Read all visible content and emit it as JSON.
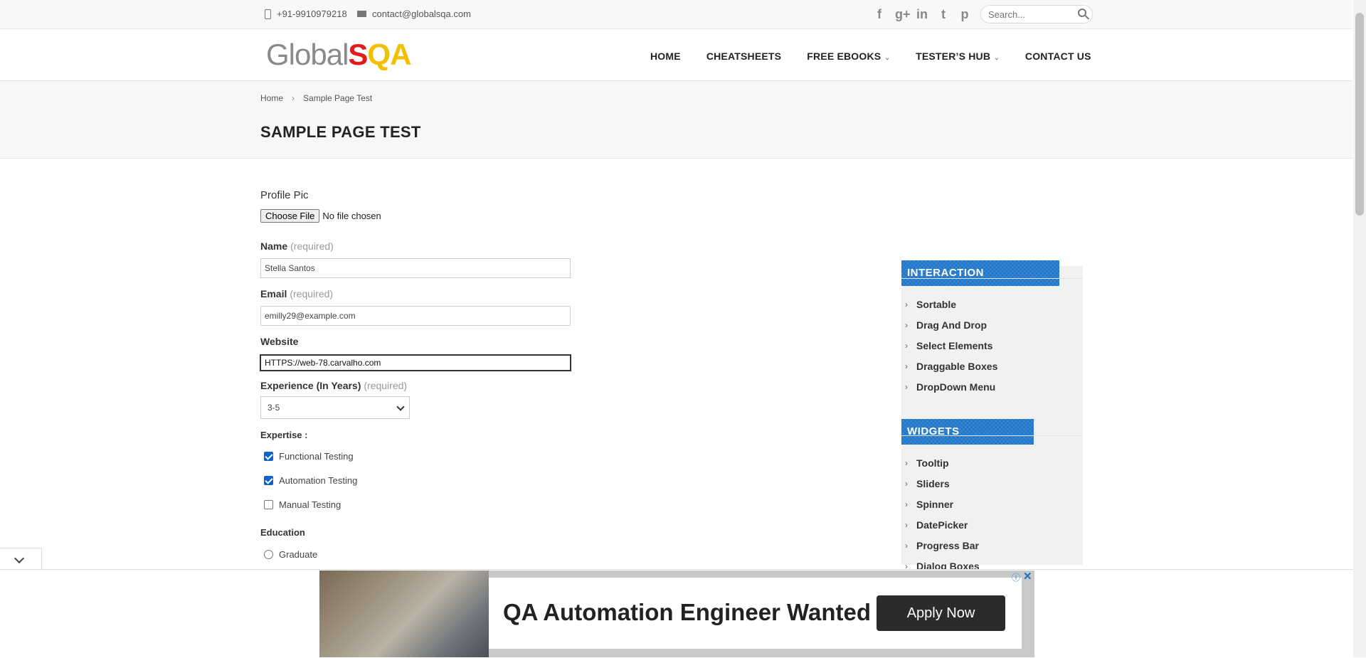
{
  "topbar": {
    "phone": "+91-9910979218",
    "email": "contact@globalsqa.com",
    "social": [
      "facebook-icon",
      "google-plus-icon",
      "linkedin-icon",
      "twitter-icon",
      "pinterest-icon"
    ],
    "social_glyphs": [
      "f",
      "g+",
      "in",
      "t",
      "p"
    ],
    "search_placeholder": "Search..."
  },
  "logo": {
    "part1": "Global",
    "part2": "S",
    "part3": "QA"
  },
  "nav": {
    "items": [
      {
        "label": "HOME",
        "dropdown": false
      },
      {
        "label": "CHEATSHEETS",
        "dropdown": false
      },
      {
        "label": "FREE EBOOKS",
        "dropdown": true
      },
      {
        "label": "TESTER’S HUB",
        "dropdown": true
      },
      {
        "label": "CONTACT US",
        "dropdown": false
      }
    ]
  },
  "breadcrumb": {
    "home": "Home",
    "separator": "›",
    "current": "Sample Page Test"
  },
  "page_title": "SAMPLE PAGE TEST",
  "form": {
    "profile_pic_label": "Profile Pic",
    "choose_file": "Choose File",
    "no_file": "No file chosen",
    "name_label": "Name",
    "required": "(required)",
    "name_value": "Stella Santos",
    "email_label": "Email",
    "email_value": "emilly29@example.com",
    "website_label": "Website",
    "website_value": "HTTPS://web-78.carvalho.com",
    "experience_label": "Experience (In Years)",
    "experience_value": "3-5",
    "expertise_label": "Expertise :",
    "expertise": [
      {
        "label": "Functional Testing",
        "checked": true
      },
      {
        "label": "Automation Testing",
        "checked": true
      },
      {
        "label": "Manual Testing",
        "checked": false
      }
    ],
    "education_label": "Education",
    "education_first": "Graduate"
  },
  "sidebar": {
    "interaction_title": "INTERACTION",
    "interaction_items": [
      "Sortable",
      "Drag And Drop",
      "Select Elements",
      "Draggable Boxes",
      "DropDown Menu"
    ],
    "widgets_title": "WIDGETS",
    "widgets_items": [
      "Tooltip",
      "Sliders",
      "Spinner",
      "DatePicker",
      "Progress Bar",
      "Dialog Boxes"
    ]
  },
  "ad": {
    "headline": "QA Automation Engineer Wanted",
    "button": "Apply Now",
    "info": "ⓘ",
    "close": "✕"
  },
  "colors": {
    "accent": "#1a73c8",
    "logo_red": "#e21b1b",
    "logo_yellow": "#f2c000",
    "checkbox": "#0b63ce"
  }
}
